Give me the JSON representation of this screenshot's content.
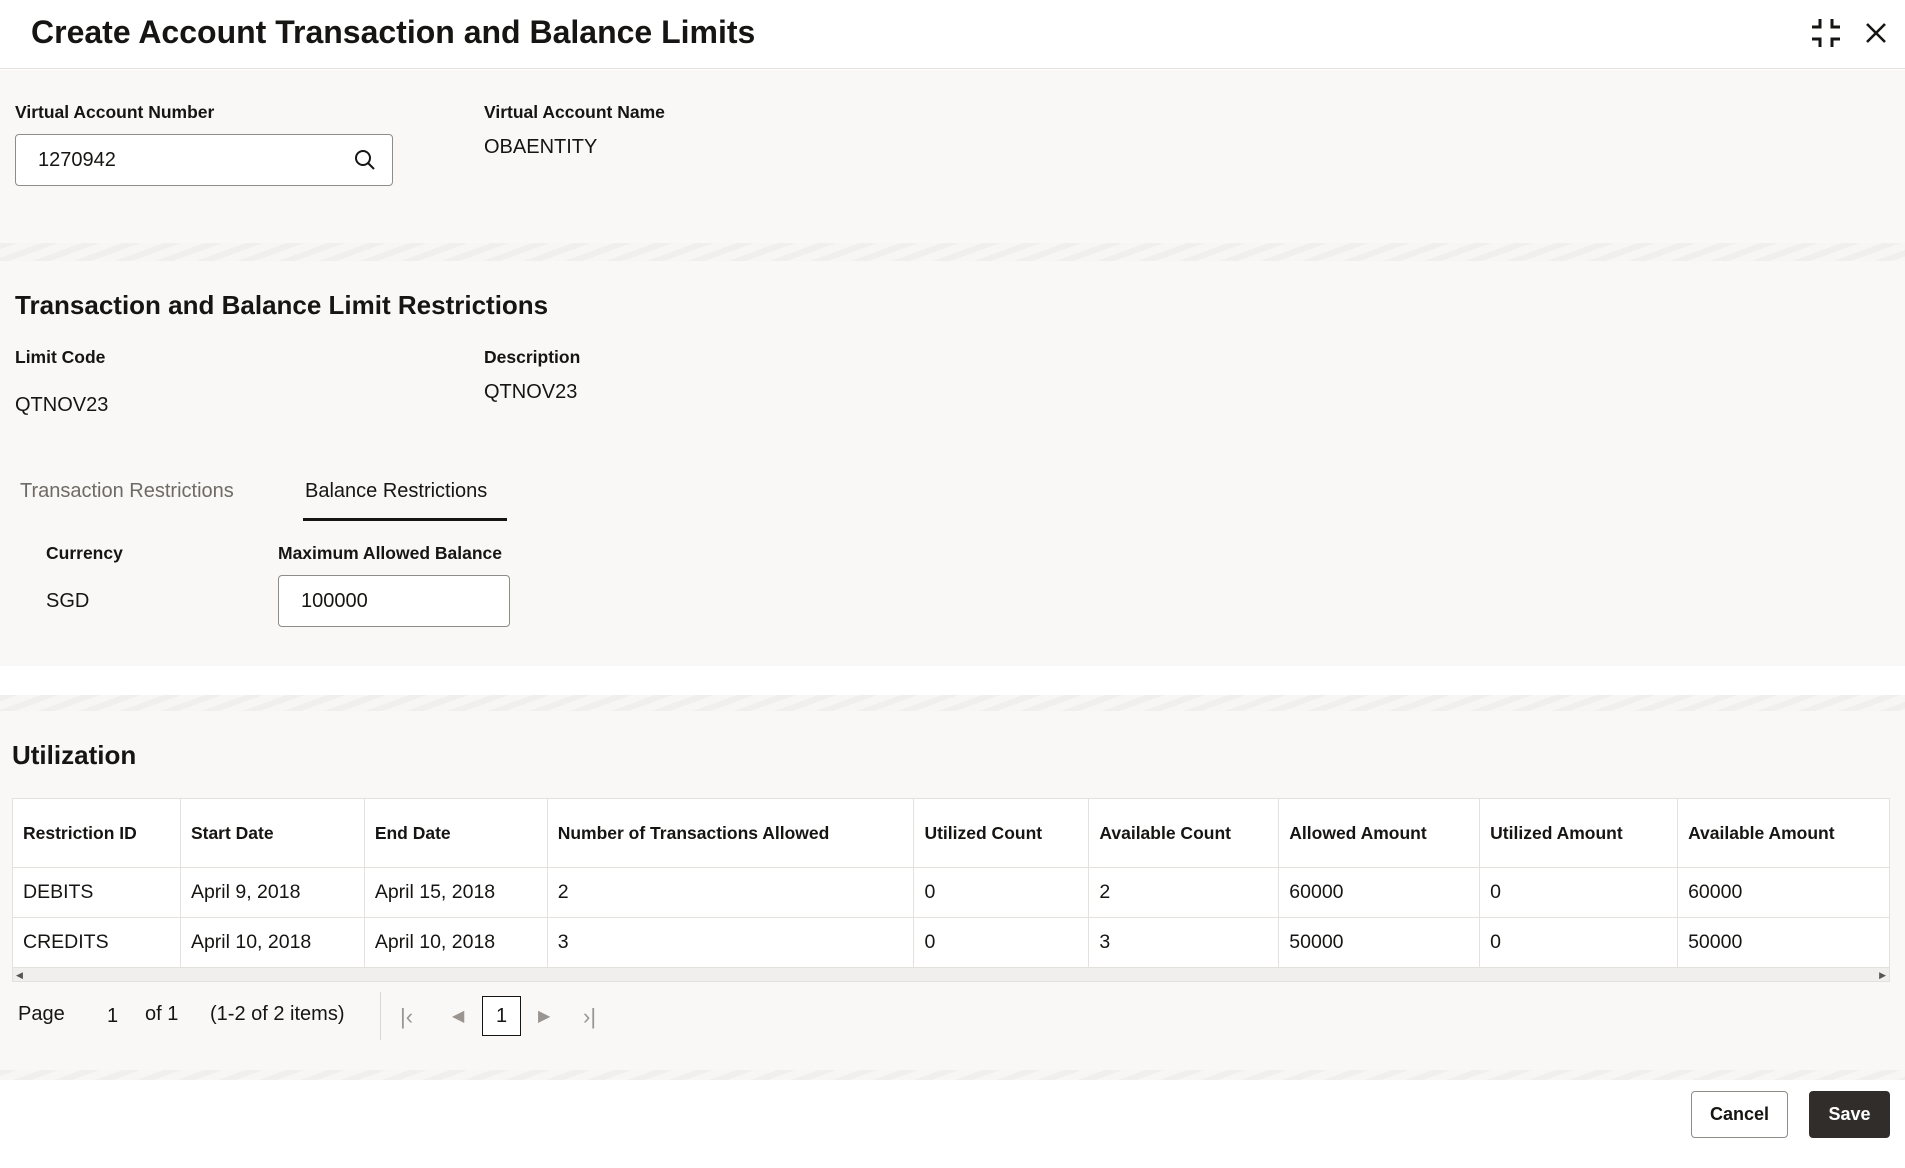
{
  "header": {
    "title": "Create Account Transaction and Balance Limits"
  },
  "account": {
    "number_label": "Virtual Account Number",
    "number_value": "1270942",
    "name_label": "Virtual Account Name",
    "name_value": "OBAENTITY"
  },
  "limits": {
    "title": "Transaction and Balance Limit Restrictions",
    "code_label": "Limit Code",
    "code_value": "QTNOV23",
    "desc_label": "Description",
    "desc_value": "QTNOV23"
  },
  "tabs": [
    {
      "label": "Transaction Restrictions"
    },
    {
      "label": "Balance Restrictions"
    }
  ],
  "balance": {
    "currency_label": "Currency",
    "currency_value": "SGD",
    "max_label": "Maximum Allowed Balance",
    "max_value": "100000"
  },
  "utilization": {
    "title": "Utilization",
    "columns": [
      "Restriction ID",
      "Start Date",
      "End Date",
      "Number of Transactions Allowed",
      "Utilized Count",
      "Available Count",
      "Allowed Amount",
      "Utilized Amount",
      "Available Amount"
    ],
    "rows": [
      [
        "DEBITS",
        "April 9, 2018",
        "April 15, 2018",
        "2",
        "0",
        "2",
        "60000",
        "0",
        "60000"
      ],
      [
        "CREDITS",
        "April 10, 2018",
        "April 10, 2018",
        "3",
        "0",
        "3",
        "50000",
        "0",
        "50000"
      ]
    ]
  },
  "pagination": {
    "page_label": "Page",
    "page_value": "1",
    "of_label": "of 1",
    "items_label": "(1-2 of 2 items)",
    "current": "1"
  },
  "footer": {
    "cancel": "Cancel",
    "save": "Save"
  }
}
